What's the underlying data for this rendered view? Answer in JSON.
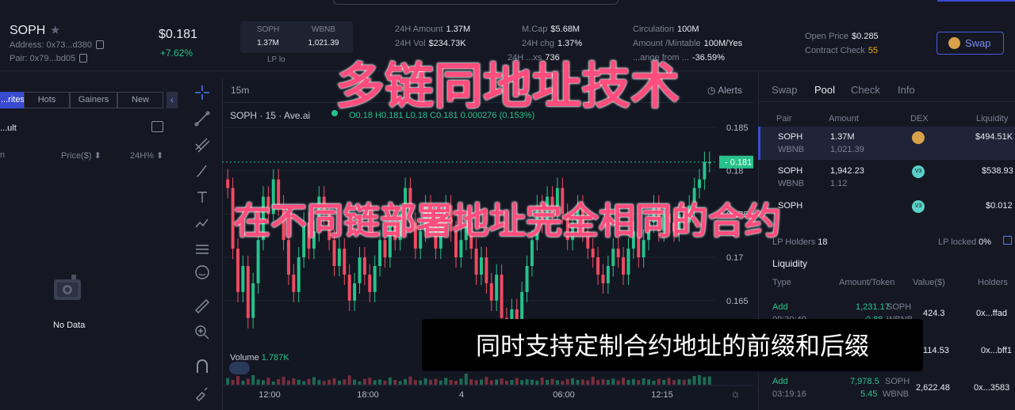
{
  "header": {
    "token": "SOPH",
    "address": "Address: 0x73...d380",
    "pair": "Pair: 0x79...bd05",
    "price": "$0.181",
    "change": "+7.62%",
    "pair_box": {
      "left_symbol": "SOPH",
      "left_value": "1.37M",
      "right_symbol": "WBNB",
      "right_value": "1,021.39",
      "lp_label": "LP lo"
    },
    "stats": {
      "amount24h_label": "24H Amount",
      "amount24h": "1.37M",
      "vol24h_label": "24H Vol",
      "vol24h": "$234.73K",
      "txs_label": "24H ...xs",
      "txs": "736",
      "mcap_label": "M.Cap",
      "mcap": "$5.68M",
      "chg24h_label": "24H chg",
      "chg24h": "1.37%",
      "circ_label": "Circulation",
      "circ": "100M",
      "mintable_label": "Amount /Mintable",
      "mintable": "100M/Yes",
      "change_from_label": "...ange from ...",
      "change_from": "-36.59%",
      "open_price_label": "Open Price",
      "open_price": "$0.285",
      "contract_check_label": "Contract Check",
      "contract_check": "55"
    },
    "swap_button": "Swap"
  },
  "left": {
    "tabs": [
      "...rites",
      "Hots",
      "Gainers",
      "New"
    ],
    "result_label": "...ult",
    "col_price": "Price($)",
    "col_24h": "24H%",
    "col_n": "n",
    "empty": "No Data"
  },
  "chart": {
    "interval": "15m",
    "alerts": "Alerts",
    "legend": "SOPH · 15 · Ave.ai",
    "ohlc": "O0.18 H0.181 L0.18 C0.181 0.000276 (0.153%)",
    "volume_label": "Volume",
    "volume_value": "1.787K",
    "last_price_tag": "0.181"
  },
  "chart_data": {
    "type": "candlestick",
    "y_ticks": [
      "0.185",
      "0.18",
      "0.175",
      "0.17",
      "0.165"
    ],
    "x_ticks": [
      "12:00",
      "18:00",
      "4",
      "06:00",
      "12:15"
    ],
    "ylim": [
      0.1595,
      0.186
    ],
    "last_price": 0.181,
    "volume": [
      0.42,
      0.3,
      0.55,
      0.25,
      0.38,
      0.6,
      0.33,
      0.28,
      0.45,
      0.2,
      0.35,
      0.5,
      0.27,
      0.4,
      0.31,
      0.22,
      0.36,
      0.48,
      0.29,
      0.24,
      0.3,
      0.41,
      0.26,
      0.34,
      0.58,
      0.32,
      0.21,
      0.37,
      0.44,
      0.28,
      0.33,
      0.25,
      0.46,
      0.3,
      0.23,
      0.35,
      0.52,
      0.29,
      0.27,
      0.4,
      0.31,
      0.36,
      0.26,
      0.43,
      0.3,
      0.24,
      0.38,
      0.7,
      0.34,
      0.28,
      0.32,
      0.49,
      0.27,
      0.33,
      0.39,
      0.25,
      0.3,
      0.42,
      0.29,
      0.35,
      0.31,
      0.26,
      0.45,
      0.3,
      0.37,
      0.28,
      0.24,
      0.36,
      0.41,
      0.3,
      0.33,
      0.27,
      0.5,
      0.29,
      0.34,
      0.31,
      0.38,
      0.26,
      0.44,
      0.3,
      0.35,
      0.28,
      0.4,
      0.33,
      0.25,
      0.37,
      0.3,
      0.42,
      0.29,
      0.34,
      0.31,
      0.36,
      0.55,
      0.6,
      0.48,
      0.52
    ],
    "closes": [
      0.178,
      0.171,
      0.166,
      0.169,
      0.163,
      0.167,
      0.172,
      0.177,
      0.175,
      0.179,
      0.176,
      0.172,
      0.168,
      0.166,
      0.17,
      0.174,
      0.171,
      0.173,
      0.177,
      0.175,
      0.172,
      0.169,
      0.171,
      0.168,
      0.165,
      0.167,
      0.17,
      0.168,
      0.166,
      0.169,
      0.172,
      0.17,
      0.174,
      0.172,
      0.175,
      0.178,
      0.174,
      0.171,
      0.173,
      0.176,
      0.174,
      0.171,
      0.174,
      0.176,
      0.173,
      0.17,
      0.172,
      0.174,
      0.171,
      0.168,
      0.17,
      0.167,
      0.165,
      0.168,
      0.163,
      0.161,
      0.164,
      0.162,
      0.166,
      0.169,
      0.172,
      0.176,
      0.174,
      0.177,
      0.175,
      0.178,
      0.175,
      0.172,
      0.174,
      0.176,
      0.173,
      0.171,
      0.17,
      0.168,
      0.167,
      0.169,
      0.171,
      0.17,
      0.168,
      0.171,
      0.173,
      0.17,
      0.172,
      0.174,
      0.176,
      0.173,
      0.175,
      0.174,
      0.173,
      0.175,
      0.174,
      0.176,
      0.178,
      0.179,
      0.181,
      0.181
    ]
  },
  "right": {
    "tabs": [
      "Swap",
      "Pool",
      "Check",
      "Info"
    ],
    "active_tab": "Pool",
    "cols": {
      "pair": "Pair",
      "amount": "Amount",
      "dex": "DEX",
      "liquidity": "Liquidity"
    },
    "pools": [
      {
        "pair_top": "SOPH",
        "pair_bottom": "WBNB",
        "amount_top": "1.37M",
        "amount_bottom": "1,021.39",
        "dex": "pancake",
        "liquidity": "$494.51K"
      },
      {
        "pair_top": "SOPH",
        "pair_bottom": "WBNB",
        "amount_top": "1,942.23",
        "amount_bottom": "1.12",
        "dex": "V3",
        "liquidity": "$538.93"
      },
      {
        "pair_top": "SOPH",
        "pair_bottom": "",
        "amount_top": "",
        "amount_bottom": "",
        "dex": "V3",
        "liquidity": "$0.012"
      }
    ],
    "lp_holders_label": "LP Holders",
    "lp_holders": "18",
    "lp_locked_label": "LP locked",
    "lp_locked": "0%",
    "liquidity_title": "Liquidity",
    "liq_cols": {
      "type": "Type",
      "amount": "Amount/Token",
      "value": "Value($)",
      "holders": "Holders"
    },
    "liq_rows": [
      {
        "type": "Add",
        "time": "09:30:49",
        "amount_top": "1,231.17",
        "token_top": "SOPH",
        "amount_bottom": "0.88",
        "token_bottom": "WBNB",
        "value": "424.3",
        "holder": "0x...ffad"
      },
      {
        "type": "",
        "time": "",
        "amount_top": "",
        "token_top": "",
        "amount_bottom": "",
        "token_bottom": "",
        "value": "114.53",
        "holder": "0x...bff1"
      },
      {
        "type": "Add",
        "time": "03:19:16",
        "amount_top": "7,978.5",
        "token_top": "SOPH",
        "amount_bottom": "5.45",
        "token_bottom": "WBNB",
        "value": "2,622.48",
        "holder": "0x...3583"
      }
    ]
  },
  "overlay": {
    "title": "多链同地址技术",
    "subtitle": "在不同链部署地址完全相同的合约",
    "caption": "同时支持定制合约地址的前缀和后缀"
  },
  "colors": {
    "up": "#27c28c",
    "down": "#f04a62",
    "accent": "#3a4bd1",
    "overlay": "#ff4d7d"
  }
}
